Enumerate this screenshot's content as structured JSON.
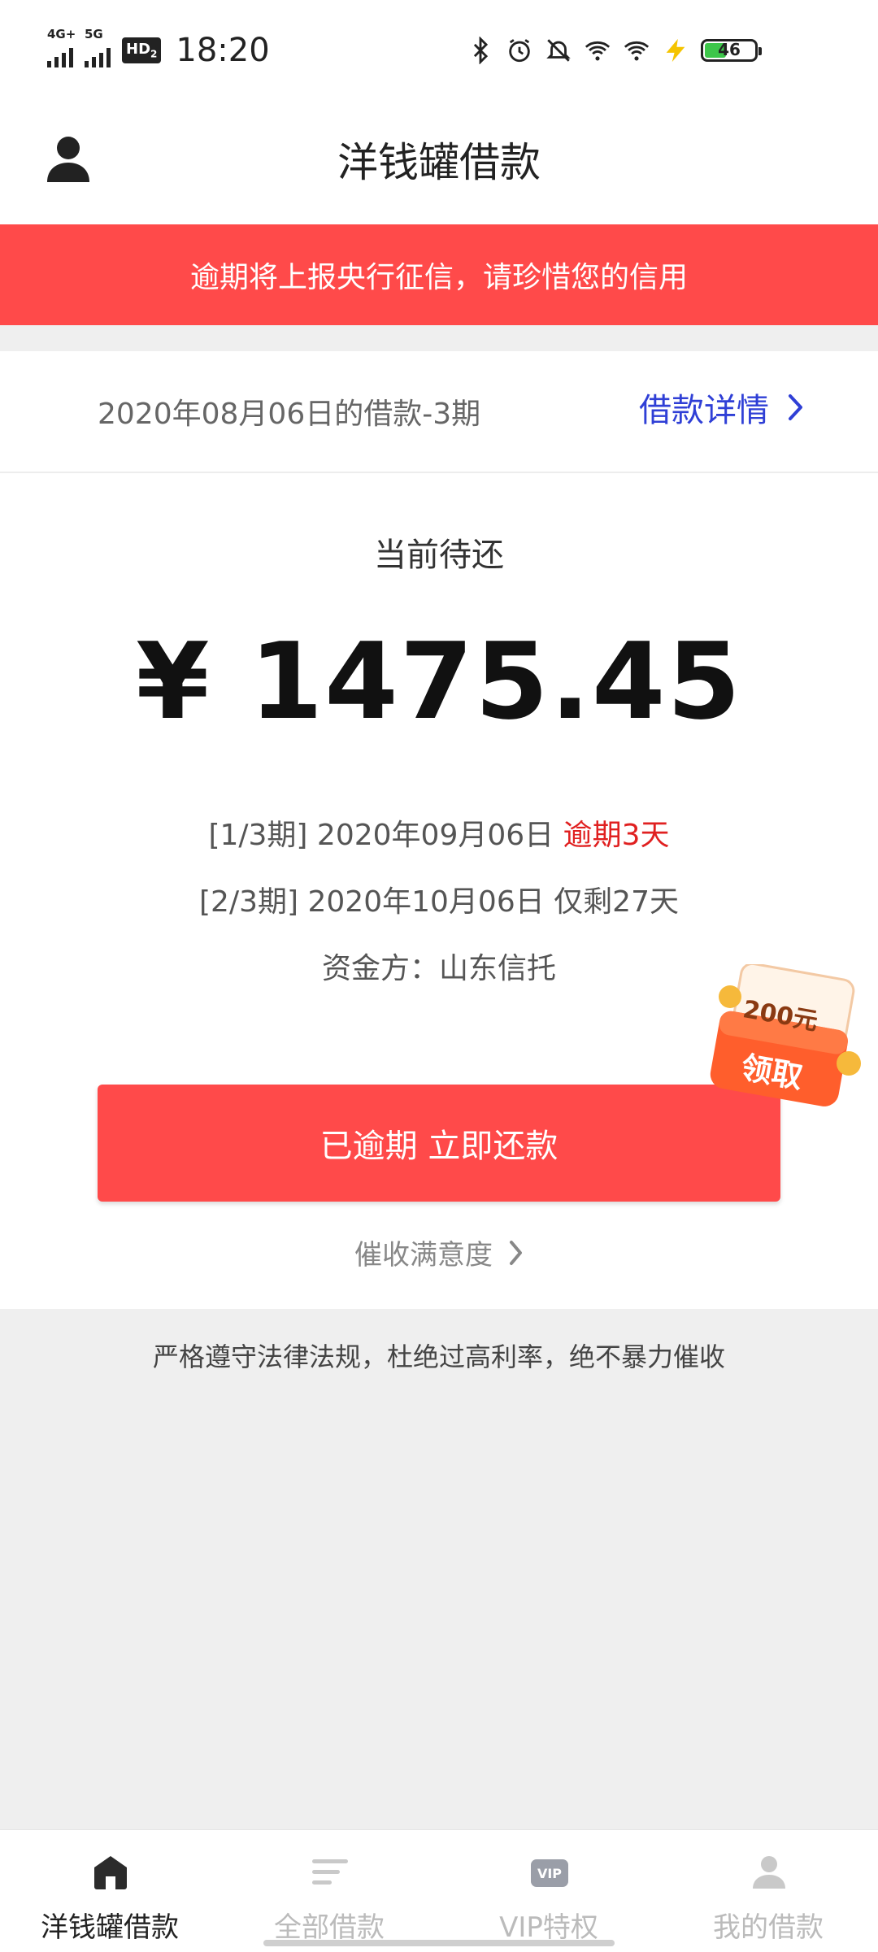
{
  "status_bar": {
    "network1": "4G+",
    "network2": "5G",
    "hd_label": "HD",
    "hd_sub": "2",
    "time": "18:20",
    "battery": "46",
    "battery_level_percent": 46
  },
  "header": {
    "title": "洋钱罐借款"
  },
  "alert": {
    "text": "逾期将上报央行征信，请珍惜您的信用"
  },
  "loan": {
    "date_label": "2020年08月06日的借款-3期",
    "detail_link": "借款详情"
  },
  "due": {
    "label": "当前待还",
    "amount": "¥ 1475.45",
    "installment1_prefix": "[1/3期] 2020年09月06日",
    "installment1_status": "逾期3天",
    "installment2": "[2/3期] 2020年10月06日 仅剩27天",
    "funder": "资金方：山东信托"
  },
  "coupon": {
    "amount": "200元",
    "action": "领取"
  },
  "actions": {
    "pay_button": "已逾期 立即还款",
    "satisfaction": "催收满意度"
  },
  "footer_note": "严格遵守法律法规，杜绝过高利率，绝不暴力催收",
  "tabs": [
    {
      "label": "洋钱罐借款",
      "icon": "home-icon",
      "active": true
    },
    {
      "label": "全部借款",
      "icon": "list-icon",
      "active": false
    },
    {
      "label": "VIP特权",
      "icon": "vip-icon",
      "active": false
    },
    {
      "label": "我的借款",
      "icon": "person-icon",
      "active": false
    }
  ],
  "colors": {
    "alert_red": "#ff4a4a",
    "link_blue": "#2f3fd6",
    "overdue_red": "#e02020",
    "background": "#efefef"
  }
}
